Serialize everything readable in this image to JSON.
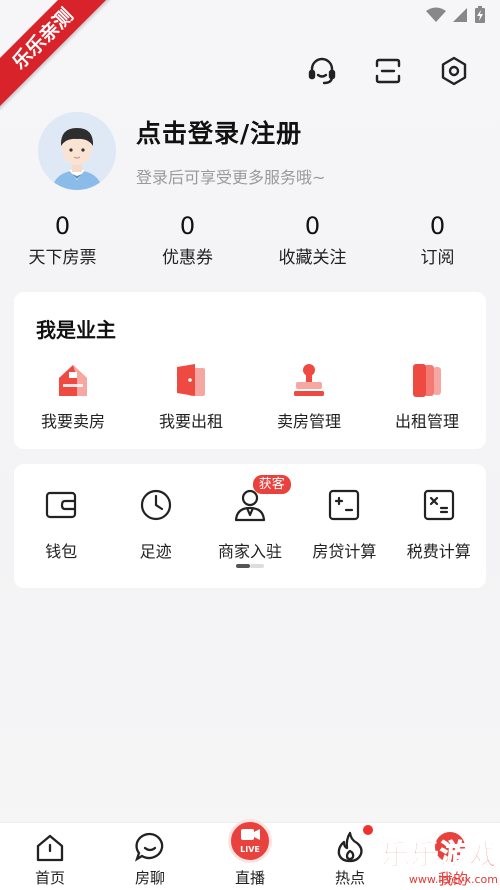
{
  "watermark": {
    "ribbon": "乐乐亲测",
    "brand": "乐乐游戏",
    "site": "www.leleyx.com"
  },
  "colors": {
    "accent": "#e9413d",
    "ribbon": "#d8232a"
  },
  "status_bar": {
    "icons": [
      "wifi-icon",
      "signal-icon",
      "battery-charging-icon"
    ]
  },
  "top_actions": [
    "customer-service-icon",
    "scan-icon",
    "settings-icon"
  ],
  "profile": {
    "login_text": "点击登录/注册",
    "subtitle": "登录后可享受更多服务哦~"
  },
  "stats": [
    {
      "value": "0",
      "label": "天下房票"
    },
    {
      "value": "0",
      "label": "优惠券"
    },
    {
      "value": "0",
      "label": "收藏关注"
    },
    {
      "value": "0",
      "label": "订阅"
    }
  ],
  "owner_section": {
    "title": "我是业主",
    "items": [
      {
        "label": "我要卖房",
        "icon": "house-icon"
      },
      {
        "label": "我要出租",
        "icon": "door-icon"
      },
      {
        "label": "卖房管理",
        "icon": "stamp-icon"
      },
      {
        "label": "出租管理",
        "icon": "files-icon"
      }
    ]
  },
  "tools": {
    "items": [
      {
        "label": "钱包",
        "icon": "wallet-icon"
      },
      {
        "label": "足迹",
        "icon": "clock-icon"
      },
      {
        "label": "商家入驻",
        "icon": "merchant-icon",
        "badge": "获客"
      },
      {
        "label": "房贷计算",
        "icon": "mortgage-calculator-icon"
      },
      {
        "label": "税费计算",
        "icon": "tax-calculator-icon"
      }
    ],
    "page_indicator": {
      "current": 1,
      "total": 2
    }
  },
  "tab_bar": [
    {
      "label": "首页",
      "icon": "home-icon"
    },
    {
      "label": "房聊",
      "icon": "chat-icon"
    },
    {
      "label": "直播",
      "icon": "live-icon",
      "live_text": "LIVE"
    },
    {
      "label": "热点",
      "icon": "flame-icon"
    },
    {
      "label": "我的",
      "icon": "profile-icon"
    }
  ]
}
